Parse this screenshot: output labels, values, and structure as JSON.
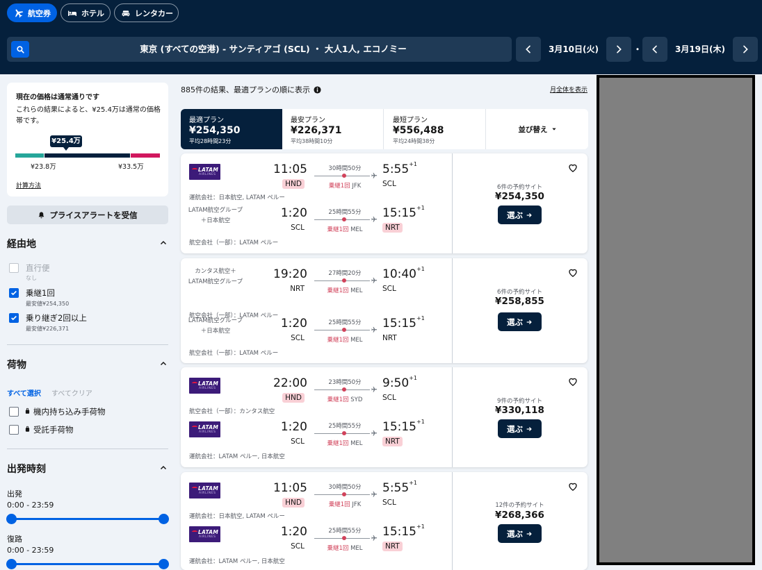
{
  "tabs": [
    {
      "label": "航空券"
    },
    {
      "label": "ホテル"
    },
    {
      "label": "レンタカー"
    }
  ],
  "search": {
    "summary": "東京 (すべての空港) - サンティアゴ (SCL) ・ 大人1人, エコノミー"
  },
  "dates": {
    "outbound": "3月10日(火)",
    "return": "3月19日(木)",
    "separator": "・"
  },
  "price_card": {
    "title": "現在の価格は通常通りです",
    "description": "これらの結果によると、¥25.4万は通常の価格帯です。",
    "current": "¥25.4万",
    "low": "¥23.8万",
    "high": "¥33.5万",
    "link": "計算方法",
    "colors": {
      "low": "#26a69a",
      "typical": "#05203c",
      "high": "#d1175e"
    }
  },
  "price_alert": {
    "label": "プライスアラートを受信"
  },
  "filters": {
    "stops": {
      "title": "経由地",
      "options": [
        {
          "label": "直行便",
          "sub": "なし",
          "checked": false,
          "disabled": true
        },
        {
          "label": "乗継1回",
          "sub": "最安値¥254,350",
          "checked": true,
          "disabled": false
        },
        {
          "label": "乗り継ぎ2回以上",
          "sub": "最安値¥226,371",
          "checked": true,
          "disabled": false
        }
      ]
    },
    "baggage": {
      "title": "荷物",
      "select_all": "すべて選択",
      "clear_all": "すべてクリア",
      "options": [
        {
          "label": "機内持ち込み手荷物"
        },
        {
          "label": "受託手荷物"
        }
      ]
    },
    "departure_times": {
      "title": "出発時刻",
      "outbound": {
        "label": "出発",
        "range": "0:00 - 23:59"
      },
      "return": {
        "label": "復路",
        "range": "0:00 - 23:59"
      }
    }
  },
  "results": {
    "count_text": "885件の結果、最適プランの順に表示",
    "show_all": "月全体を表示",
    "sort_tabs": [
      {
        "label": "最適プラン",
        "price": "¥254,350",
        "detail": "平均28時間23分"
      },
      {
        "label": "最安プラン",
        "price": "¥226,371",
        "detail": "平均38時間10分"
      },
      {
        "label": "最短プラン",
        "price": "¥556,488",
        "detail": "平均24時間38分"
      }
    ],
    "sort_by": "並び替え",
    "select_label": "選ぶ",
    "cards": [
      {
        "legs": [
          {
            "logo": "LATAM",
            "logo_sub": "AIRLINES",
            "carrier": "",
            "dep_time": "11:05",
            "dep_code": "HND",
            "arr_time": "5:55",
            "arr_plus": "+1",
            "arr_code": "SCL",
            "duration": "30時間50分",
            "stops_red": "乗継1回",
            "stops_via": "JFK",
            "operated": "運航会社：日本航空, LATAM ペルー"
          },
          {
            "logo": "",
            "logo_sub": "",
            "carrier": "LATAM航空グループ＋日本航空",
            "dep_time": "1:20",
            "dep_code": "SCL",
            "arr_time": "15:15",
            "arr_plus": "+1",
            "arr_code": "NRT",
            "duration": "25時間55分",
            "stops_red": "乗継1回",
            "stops_via": "MEL",
            "operated": "航空会社（一部）：LATAM ペルー"
          }
        ],
        "sites": "6件の予約サイト",
        "price": "¥254,350"
      },
      {
        "legs": [
          {
            "logo": "",
            "logo_sub": "",
            "carrier": "カンタス航空＋LATAM航空グループ",
            "dep_time": "19:20",
            "dep_code": "NRT",
            "arr_time": "10:40",
            "arr_plus": "+1",
            "arr_code": "SCL",
            "duration": "27時間20分",
            "stops_red": "乗継1回",
            "stops_via": "MEL",
            "operated": "航空会社（一部）：LATAM ペルー"
          },
          {
            "logo": "",
            "logo_sub": "",
            "carrier": "LATAM航空グループ＋日本航空",
            "dep_time": "1:20",
            "dep_code": "SCL",
            "arr_time": "15:15",
            "arr_plus": "+1",
            "arr_code": "NRT",
            "duration": "25時間55分",
            "stops_red": "乗継1回",
            "stops_via": "MEL",
            "operated": "航空会社（一部）：LATAM ペルー"
          }
        ],
        "sites": "6件の予約サイト",
        "price": "¥258,855"
      },
      {
        "legs": [
          {
            "logo": "LATAM",
            "logo_sub": "AIRLINES",
            "carrier": "",
            "dep_time": "22:00",
            "dep_code": "HND",
            "arr_time": "9:50",
            "arr_plus": "+1",
            "arr_code": "SCL",
            "duration": "23時間50分",
            "stops_red": "乗継1回",
            "stops_via": "SYD",
            "operated": "航空会社（一部）：カンタス航空"
          },
          {
            "logo": "LATAM",
            "logo_sub": "AIRLINES",
            "carrier": "",
            "dep_time": "1:20",
            "dep_code": "SCL",
            "arr_time": "15:15",
            "arr_plus": "+1",
            "arr_code": "NRT",
            "duration": "25時間55分",
            "stops_red": "乗継1回",
            "stops_via": "MEL",
            "operated": "運航会社：LATAM ペルー, 日本航空"
          }
        ],
        "sites": "9件の予約サイト",
        "price": "¥330,118"
      },
      {
        "legs": [
          {
            "logo": "LATAM",
            "logo_sub": "AIRLINES",
            "carrier": "",
            "dep_time": "11:05",
            "dep_code": "HND",
            "arr_time": "5:55",
            "arr_plus": "+1",
            "arr_code": "SCL",
            "duration": "30時間50分",
            "stops_red": "乗継1回",
            "stops_via": "JFK",
            "operated": "運航会社：日本航空, LATAM ペルー"
          },
          {
            "logo": "LATAM",
            "logo_sub": "AIRLINES",
            "carrier": "",
            "dep_time": "1:20",
            "dep_code": "SCL",
            "arr_time": "15:15",
            "arr_plus": "+1",
            "arr_code": "NRT",
            "duration": "25時間55分",
            "stops_red": "乗継1回",
            "stops_via": "MEL",
            "operated": "運航会社：LATAM ペルー, 日本航空"
          }
        ],
        "sites": "12件の予約サイト",
        "price": "¥268,366"
      }
    ]
  }
}
